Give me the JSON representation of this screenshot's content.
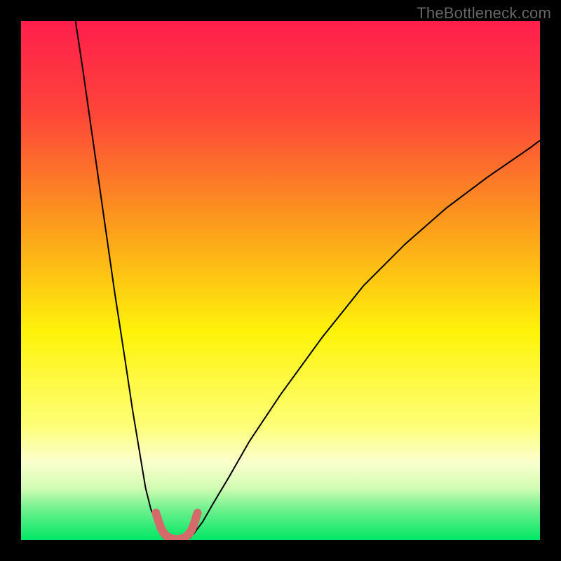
{
  "watermark": "TheBottleneck.com",
  "chart_data": {
    "type": "line",
    "title": "",
    "xlabel": "",
    "ylabel": "",
    "xlim": [
      0,
      100
    ],
    "ylim": [
      0,
      100
    ],
    "grid": false,
    "gradient_stops": [
      {
        "offset": 0,
        "color": "#ff1e4c"
      },
      {
        "offset": 18,
        "color": "#fd4639"
      },
      {
        "offset": 40,
        "color": "#fc9f1b"
      },
      {
        "offset": 60,
        "color": "#fef30a"
      },
      {
        "offset": 78,
        "color": "#feff77"
      },
      {
        "offset": 85,
        "color": "#fbffce"
      },
      {
        "offset": 90,
        "color": "#d2fcb3"
      },
      {
        "offset": 94,
        "color": "#71f18e"
      },
      {
        "offset": 100,
        "color": "#00e765"
      }
    ],
    "series": [
      {
        "name": "curve-left",
        "stroke": "#000000",
        "stroke_width": 2,
        "x": [
          10.5,
          12,
          14,
          16,
          18,
          20,
          21.5,
          23,
          24,
          25,
          26,
          27,
          27.5
        ],
        "y": [
          100,
          90,
          76,
          62,
          48,
          35,
          25,
          16,
          10,
          6,
          3.5,
          1.5,
          0.3
        ]
      },
      {
        "name": "curve-right",
        "stroke": "#000000",
        "stroke_width": 2,
        "x": [
          32.5,
          33.5,
          35,
          37,
          40,
          44,
          50,
          58,
          66,
          74,
          82,
          90,
          98,
          100
        ],
        "y": [
          0.3,
          1.5,
          3.5,
          7,
          12,
          19,
          28,
          39,
          49,
          57,
          64,
          70,
          75.5,
          77
        ]
      },
      {
        "name": "curve-bottom-pink",
        "stroke": "#d46a6a",
        "stroke_width": 12,
        "linecap": "round",
        "x": [
          26,
          26.5,
          27.0,
          27.6,
          28.4,
          29.2,
          30.0,
          30.8,
          31.6,
          32.4,
          33.0,
          33.5,
          34.0
        ],
        "y": [
          5.2,
          3.6,
          2.2,
          1.2,
          0.5,
          0.2,
          0.1,
          0.2,
          0.5,
          1.2,
          2.2,
          3.6,
          5.2
        ]
      }
    ]
  }
}
